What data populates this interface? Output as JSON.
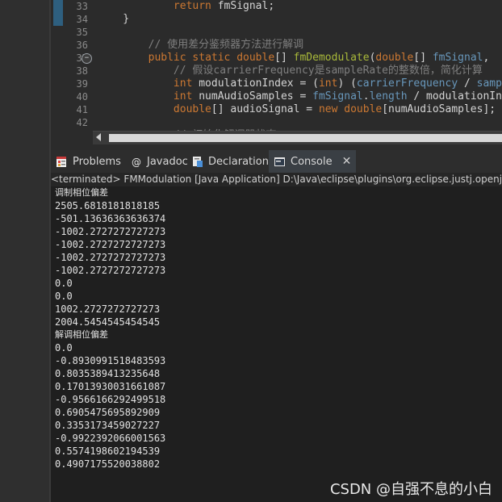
{
  "editor": {
    "lines": [
      {
        "num": "33",
        "code": [
          {
            "t": "            "
          },
          {
            "t": "return ",
            "c": "kw"
          },
          {
            "t": "fmSignal;",
            "c": "var"
          }
        ]
      },
      {
        "num": "34",
        "code": [
          {
            "t": "    }",
            "c": "var"
          }
        ]
      },
      {
        "num": "35",
        "code": []
      },
      {
        "num": "36",
        "code": [
          {
            "t": "        "
          },
          {
            "t": "// 使用差分鉴频器方法进行解调",
            "c": "cm"
          }
        ]
      },
      {
        "num": "37",
        "code": [
          {
            "t": "        "
          },
          {
            "t": "public static double",
            "c": "kw"
          },
          {
            "t": "[] ",
            "c": "var"
          },
          {
            "t": "fmDemodulate",
            "c": "fn"
          },
          {
            "t": "(",
            "c": "var"
          },
          {
            "t": "double",
            "c": "kw"
          },
          {
            "t": "[] ",
            "c": "var"
          },
          {
            "t": "fmSignal",
            "c": "pm"
          },
          {
            "t": ", ",
            "c": "var"
          }
        ]
      },
      {
        "num": "38",
        "code": [
          {
            "t": "            "
          },
          {
            "t": "// 假设carrierFrequency是sampleRate的整数倍，简化计算",
            "c": "cm"
          }
        ]
      },
      {
        "num": "39",
        "code": [
          {
            "t": "            "
          },
          {
            "t": "int ",
            "c": "kw"
          },
          {
            "t": "modulationIndex = (",
            "c": "var"
          },
          {
            "t": "int",
            "c": "kw"
          },
          {
            "t": ") (",
            "c": "var"
          },
          {
            "t": "carrierFrequency",
            "c": "pm"
          },
          {
            "t": " / ",
            "c": "var"
          },
          {
            "t": "samp",
            "c": "pm"
          }
        ]
      },
      {
        "num": "40",
        "code": [
          {
            "t": "            "
          },
          {
            "t": "int ",
            "c": "kw"
          },
          {
            "t": "numAudioSamples = ",
            "c": "var"
          },
          {
            "t": "fmSignal",
            "c": "pm"
          },
          {
            "t": ".",
            "c": "var"
          },
          {
            "t": "length",
            "c": "pm"
          },
          {
            "t": " / modulationIn",
            "c": "var"
          }
        ]
      },
      {
        "num": "41",
        "code": [
          {
            "t": "            "
          },
          {
            "t": "double",
            "c": "kw"
          },
          {
            "t": "[] audioSignal = ",
            "c": "var"
          },
          {
            "t": "new double",
            "c": "kw"
          },
          {
            "t": "[numAudioSamples];",
            "c": "var"
          }
        ]
      },
      {
        "num": "42",
        "code": []
      },
      {
        "num": "43",
        "code": [
          {
            "t": "            "
          },
          {
            "t": "// 初始化解调器状态",
            "c": "cm"
          }
        ]
      }
    ]
  },
  "tabs": [
    {
      "label": "Problems",
      "icon": "problems-icon"
    },
    {
      "label": "Javadoc",
      "icon": "javadoc-icon"
    },
    {
      "label": "Declaration",
      "icon": "declaration-icon"
    },
    {
      "label": "Console",
      "icon": "console-icon",
      "active": true
    }
  ],
  "console": {
    "header": "<terminated> FMModulation [Java Application] D:\\Java\\eclipse\\plugins\\org.eclipse.justj.openjdk",
    "lines": [
      "调制相位偏差",
      "2505.6818181818185",
      "-501.13636363636374",
      "-1002.2727272727273",
      "-1002.2727272727273",
      "-1002.2727272727273",
      "-1002.2727272727273",
      "0.0",
      "0.0",
      "1002.2727272727273",
      "2004.5454545454545",
      "解调相位偏差",
      "0.0",
      "-0.8930991518483593",
      "0.8035389413235648",
      "0.17013930031661087",
      "-0.9566166292499518",
      "0.6905475695892909",
      "0.3353173459027227",
      "-0.9922392066001563",
      "0.5574198602194539",
      "0.4907175520038802"
    ]
  },
  "watermark": "CSDN @自强不息的小白"
}
